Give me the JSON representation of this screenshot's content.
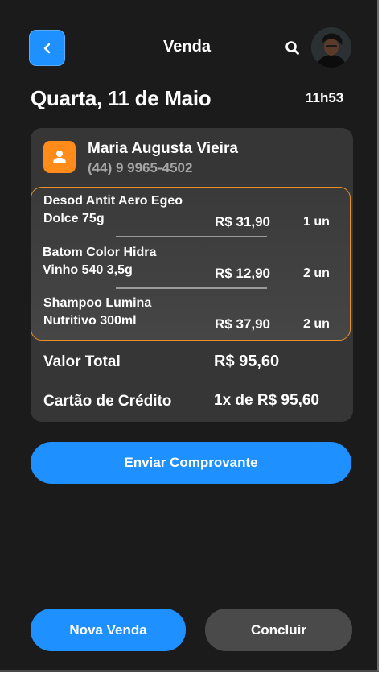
{
  "header": {
    "title": "Venda",
    "back_icon": "chevron-left-icon",
    "search_icon": "search-icon",
    "accent": "#1e90ff"
  },
  "datetime": {
    "date": "Quarta, 11 de Maio",
    "time": "11h53"
  },
  "client": {
    "name": "Maria Augusta Vieira",
    "phone": "(44) 9 9965-4502",
    "icon": "user-icon",
    "icon_color": "#ff8c1a"
  },
  "items": [
    {
      "line1": "Desod Antit Aero Egeo",
      "line2": "Dolce 75g",
      "price": "R$ 31,90",
      "qty": "1 un"
    },
    {
      "line1": "Batom Color Hidra",
      "line2": "Vinho 540 3,5g",
      "price": "R$ 12,90",
      "qty": "2 un"
    },
    {
      "line1": "Shampoo Lumina",
      "line2": "Nutritivo 300ml",
      "price": "R$ 37,90",
      "qty": "2 un"
    }
  ],
  "summary": {
    "total_label": "Valor Total",
    "total_value": "R$ 95,60",
    "payment_label": "Cartão de Crédito",
    "payment_value": "1x de R$ 95,60"
  },
  "actions": {
    "send_receipt": "Enviar Comprovante",
    "new_sale": "Nova Venda",
    "finish": "Concluir"
  }
}
